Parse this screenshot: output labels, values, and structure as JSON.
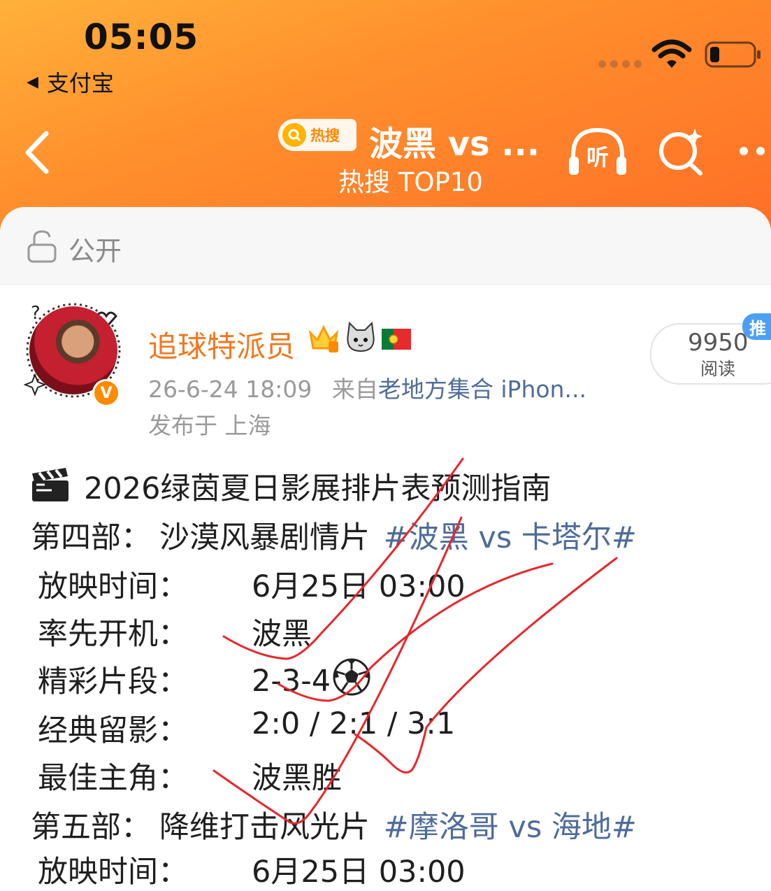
{
  "status_bar": {
    "time": "05:05",
    "back_app": "支付宝"
  },
  "nav": {
    "badge": "热搜",
    "title": "波黑 vs ...",
    "subtitle": "热搜 TOP10"
  },
  "visibility": {
    "label": "公开"
  },
  "post": {
    "username": "追球特派员",
    "date": "26-6-24 18:09",
    "source_prefix": "来自",
    "source": "老地方集合 iPhon...",
    "location": "发布于 上海",
    "read_count": "9950",
    "read_label": "阅读",
    "promo_badge": "推",
    "verified": "V"
  },
  "body": {
    "title": "2026绿茵夏日影展排片表预测指南",
    "part4_label": "第四部：",
    "part4_genre": "沙漠风暴剧情片",
    "part4_tag": "#波黑 vs 卡塔尔#",
    "rows": [
      {
        "label": "放映时间：",
        "value": "6月25日 03:00"
      },
      {
        "label": "率先开机：",
        "value": "波黑"
      },
      {
        "label": "精彩片段：",
        "value": "2-3-4"
      },
      {
        "label": "经典留影：",
        "value": "2:0 / 2:1 / 3:1"
      },
      {
        "label": "最佳主角：",
        "value": "波黑胜"
      }
    ],
    "part5_label": "第五部：",
    "part5_genre": "降维打击风光片",
    "part5_tag": "#摩洛哥 vs 海地#",
    "cut_row_label": "放映时间：",
    "cut_row_value": "6月25日 03:00"
  },
  "colors": {
    "accent_orange": "#ff8a2c",
    "username": "#f2771f",
    "topic_link": "#4e6c99",
    "annotation_red": "#e8262a",
    "read_badge": "#4d9ff3"
  }
}
